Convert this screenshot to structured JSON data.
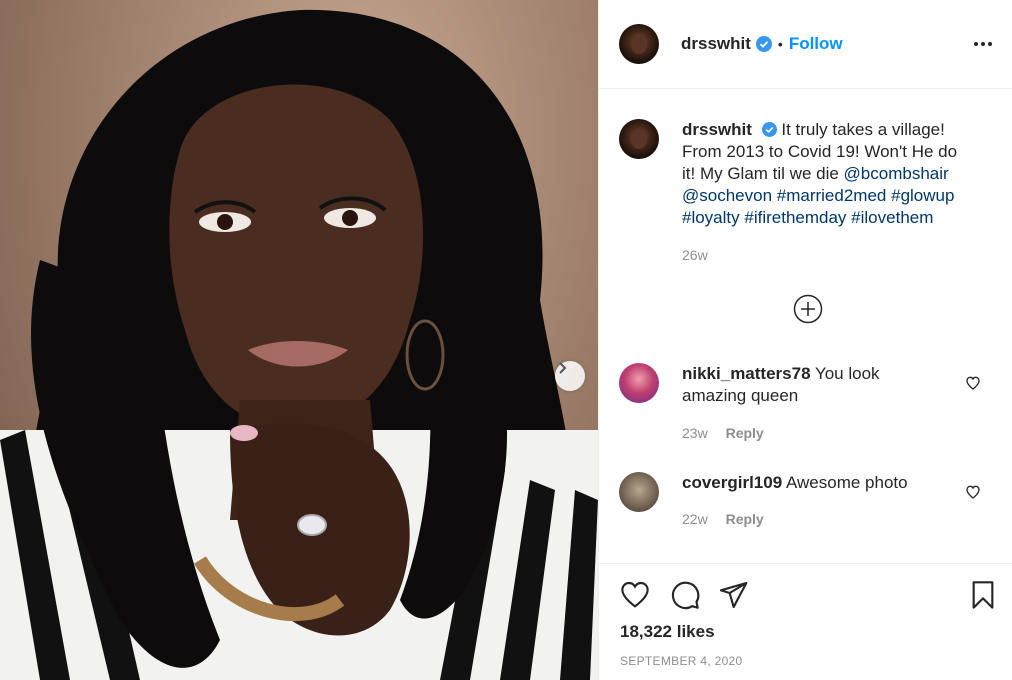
{
  "post": {
    "username": "drsswhit",
    "follow_label": "Follow",
    "dot": "•",
    "likes": "18,322 likes",
    "date": "SEPTEMBER 4, 2020"
  },
  "caption": {
    "username": "drsswhit",
    "text": "It truly takes a village! From 2013 to Covid 19! Won't He do it! My Glam til we die",
    "mentions": [
      "@bcombshair",
      "@sochevon"
    ],
    "hashtags": [
      "#married2med",
      "#glowup",
      "#loyalty",
      "#ifirethemday",
      "#ilovethem"
    ],
    "time": "26w"
  },
  "comments": [
    {
      "username": "nikki_matters78",
      "text": "You look amazing queen",
      "time": "23w",
      "reply": "Reply"
    },
    {
      "username": "covergirl109",
      "text": "Awesome photo",
      "time": "22w",
      "reply": "Reply"
    }
  ],
  "icons": {
    "verified": "verified-badge-icon",
    "more": "more-options-icon",
    "next": "chevron-right-icon",
    "load_more": "plus-circle-icon",
    "like": "heart-icon",
    "comment": "comment-icon",
    "share": "paper-plane-icon",
    "save": "bookmark-icon"
  },
  "colors": {
    "accent": "#0095f6",
    "link": "#00376b",
    "verified": "#3897f0",
    "muted": "#8e8e8e"
  }
}
